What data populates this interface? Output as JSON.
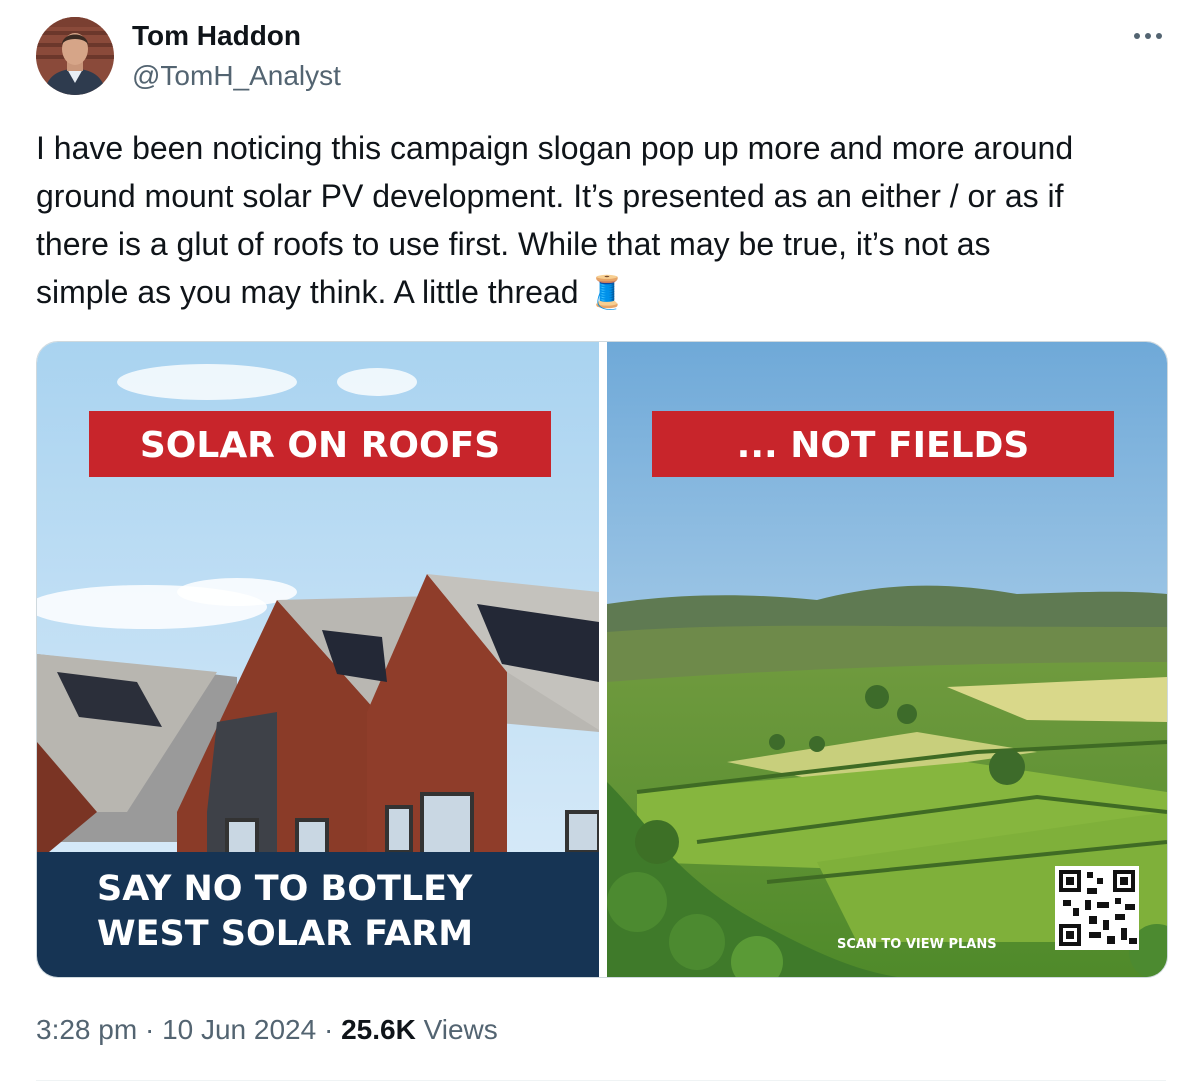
{
  "author": {
    "name": "Tom Haddon",
    "handle": "@TomH_Analyst"
  },
  "tweet": {
    "text": "I have been noticing this campaign slogan pop up more and more around\nground mount solar PV development. It’s presented as an either / or as if\nthere is a glut of roofs to use first. While that may be true, it’s not as\nsimple as you may think. A little thread 🧵"
  },
  "media": {
    "left_banner": "SOLAR ON ROOFS",
    "right_banner": "... NOT FIELDS",
    "bottom_line1": "SAY NO TO BOTLEY",
    "bottom_line2": "WEST SOLAR FARM",
    "scan_label": "SCAN TO VIEW PLANS"
  },
  "meta": {
    "time": "3:28 pm",
    "separator": "·",
    "date": "10 Jun 2024",
    "views_count": "25.6K",
    "views_label": "Views"
  },
  "icons": {
    "more": "more-horizontal-icon"
  },
  "colors": {
    "banner_red": "#c8252b",
    "panel_navy": "#163454",
    "text_secondary": "#536471"
  }
}
